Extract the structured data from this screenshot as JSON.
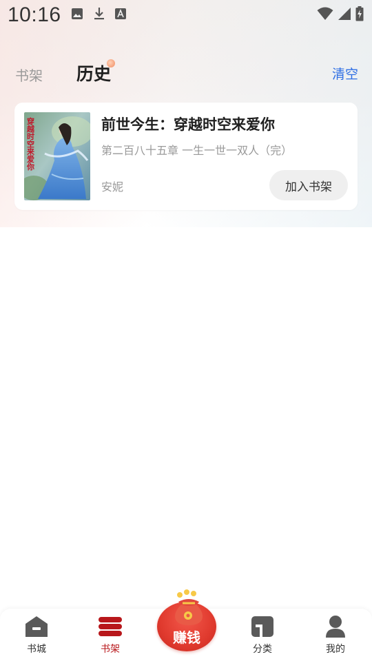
{
  "status_bar": {
    "time": "10:16",
    "left_icons": [
      "image-icon",
      "download-icon",
      "font-icon"
    ],
    "right_icons": [
      "wifi-icon",
      "signal-icon",
      "battery-charging-icon"
    ]
  },
  "header": {
    "tab_shelf": "书架",
    "tab_history": "历史",
    "clear_label": "清空"
  },
  "books": [
    {
      "title": "前世今生：穿越时空来爱你",
      "chapter": "第二百八十五章 一生一世一双人（完）",
      "author": "安妮",
      "add_label": "加入书架",
      "cover_text": "穿越时空来爱你"
    }
  ],
  "bottom_nav": {
    "items": [
      {
        "label": "书城",
        "icon": "store-icon",
        "active": false
      },
      {
        "label": "书架",
        "icon": "bookshelf-icon",
        "active": true
      },
      {
        "label": "分类",
        "icon": "category-icon",
        "active": false
      },
      {
        "label": "我的",
        "icon": "user-icon",
        "active": false
      }
    ],
    "earn_label": "赚钱"
  },
  "colors": {
    "accent_red": "#b8171b",
    "link_blue": "#2f6fe4",
    "earn_red": "#e03a2e"
  }
}
